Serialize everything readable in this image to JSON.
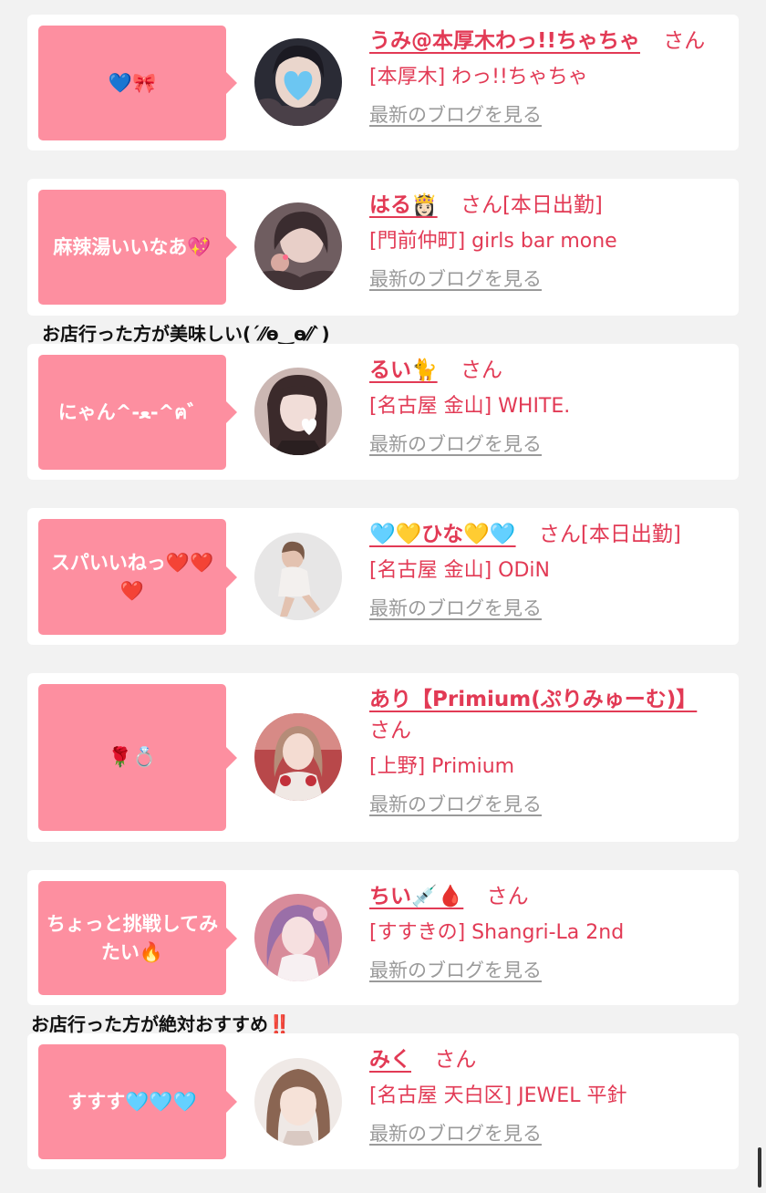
{
  "entries": [
    {
      "message": "💙🎀",
      "name": "うみ@本厚木わっ!!ちゃちゃ",
      "suffix": "さん",
      "shop": "[本厚木] わっ!!ちゃちゃ",
      "blog_link": "最新のブログを見る"
    },
    {
      "message": "麻辣湯いいなあ💖",
      "name": "はる👸🏻",
      "suffix": "さん[本日出勤]",
      "shop": "[門前仲町] girls bar mone",
      "blog_link": "最新のブログを見る"
    },
    {
      "message": "にゃん^-ﻌ-^ฅ゛",
      "name": "るい🐈",
      "suffix": "さん",
      "shop": "[名古屋 金山] WHITE.",
      "blog_link": "最新のブログを見る"
    },
    {
      "message": "スパいいねっ❤️❤️❤️",
      "name": "🩵💛ひな💛🩵",
      "suffix": "さん[本日出勤]",
      "shop": "[名古屋 金山] ODiN",
      "blog_link": "最新のブログを見る"
    },
    {
      "message": "🌹💍",
      "name": "あり【Primium(ぷりみゅーむ)】",
      "suffix": "さん",
      "shop": "[上野] Primium",
      "blog_link": "最新のブログを見る"
    },
    {
      "message": "ちょっと挑戦してみたい🔥",
      "name": "ちい💉🩸",
      "suffix": "さん",
      "shop": "[すすきの] Shangri-La 2nd",
      "blog_link": "最新のブログを見る"
    },
    {
      "message": "すすす🩵🩵🩵",
      "name": "みく",
      "suffix": "さん",
      "shop": "[名古屋 天白区] JEWEL 平針",
      "blog_link": "最新のブログを見る"
    }
  ],
  "notes": {
    "note1": "お店行った方が美味しい(ˊ⁄⁄ɵ‿ɵ⁄⁄ˋ)",
    "note2": "お店行った方が絶対おすすめ",
    "note2_mark": "‼️"
  },
  "colors": {
    "accent": "#e23a55",
    "bubble": "#fd8fa0",
    "link_gray": "#9a9a9a",
    "background": "#f2f2f2"
  }
}
